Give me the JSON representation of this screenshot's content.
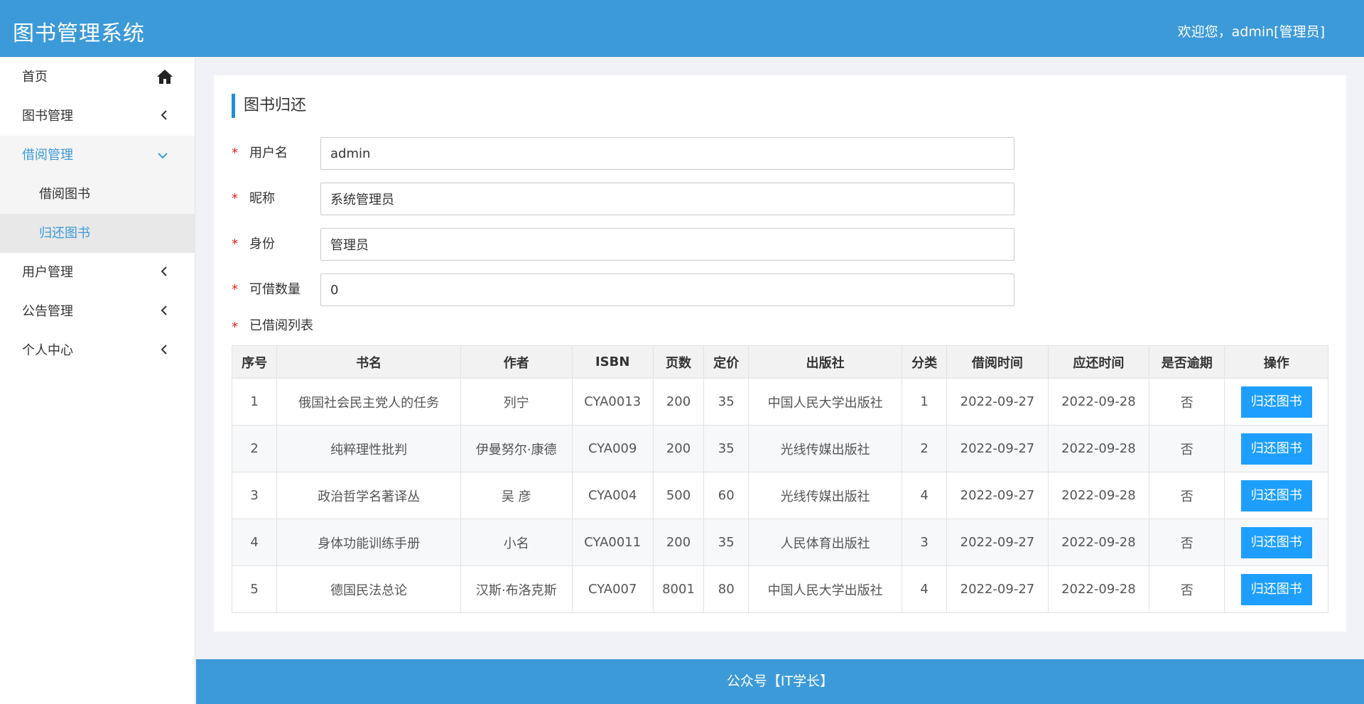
{
  "header": {
    "app_title": "图书管理系统",
    "welcome": "欢迎您，admin[管理员]"
  },
  "sidebar": {
    "items": [
      {
        "label": "首页",
        "icon": "home-icon"
      },
      {
        "label": "图书管理",
        "icon": "chevron-left-icon"
      },
      {
        "label": "借阅管理",
        "icon": "chevron-down-icon",
        "expanded": true,
        "children": [
          {
            "label": "借阅图书"
          },
          {
            "label": "归还图书",
            "active": true
          }
        ]
      },
      {
        "label": "用户管理",
        "icon": "chevron-left-icon"
      },
      {
        "label": "公告管理",
        "icon": "chevron-left-icon"
      },
      {
        "label": "个人中心",
        "icon": "chevron-left-icon"
      }
    ]
  },
  "page": {
    "title": "图书归还"
  },
  "form": {
    "required_mark": "*",
    "username": {
      "label": "用户名",
      "value": "admin"
    },
    "nickname": {
      "label": "昵称",
      "value": "系统管理员"
    },
    "role": {
      "label": "身份",
      "value": "管理员"
    },
    "quota": {
      "label": "可借数量",
      "value": "0"
    },
    "borrowed_list_label": "已借阅列表"
  },
  "table": {
    "columns": [
      "序号",
      "书名",
      "作者",
      "ISBN",
      "页数",
      "定价",
      "出版社",
      "分类",
      "借阅时间",
      "应还时间",
      "是否逾期",
      "操作"
    ],
    "rows": [
      {
        "no": "1",
        "title": "俄国社会民主党人的任务",
        "author": "列宁",
        "isbn": "CYA0013",
        "pages": "200",
        "price": "35",
        "publisher": "中国人民大学出版社",
        "category": "1",
        "borrow_date": "2022-09-27",
        "due_date": "2022-09-28",
        "overdue": "否",
        "action": "归还图书"
      },
      {
        "no": "2",
        "title": "纯粹理性批判",
        "author": "伊曼努尔·康德",
        "isbn": "CYA009",
        "pages": "200",
        "price": "35",
        "publisher": "光线传媒出版社",
        "category": "2",
        "borrow_date": "2022-09-27",
        "due_date": "2022-09-28",
        "overdue": "否",
        "action": "归还图书"
      },
      {
        "no": "3",
        "title": "政治哲学名著译丛",
        "author": "吴 彦",
        "isbn": "CYA004",
        "pages": "500",
        "price": "60",
        "publisher": "光线传媒出版社",
        "category": "4",
        "borrow_date": "2022-09-27",
        "due_date": "2022-09-28",
        "overdue": "否",
        "action": "归还图书"
      },
      {
        "no": "4",
        "title": "身体功能训练手册",
        "author": "小名",
        "isbn": "CYA0011",
        "pages": "200",
        "price": "35",
        "publisher": "人民体育出版社",
        "category": "3",
        "borrow_date": "2022-09-27",
        "due_date": "2022-09-28",
        "overdue": "否",
        "action": "归还图书"
      },
      {
        "no": "5",
        "title": "德国民法总论",
        "author": "汉斯·布洛克斯",
        "isbn": "CYA007",
        "pages": "8001",
        "price": "80",
        "publisher": "中国人民大学出版社",
        "category": "4",
        "borrow_date": "2022-09-27",
        "due_date": "2022-09-28",
        "overdue": "否",
        "action": "归还图书"
      }
    ]
  },
  "footer": {
    "text": "公众号【IT学长】"
  },
  "colors": {
    "header_bg": "#3c9ad9",
    "accent": "#1e9fff",
    "required": "#e02020"
  }
}
